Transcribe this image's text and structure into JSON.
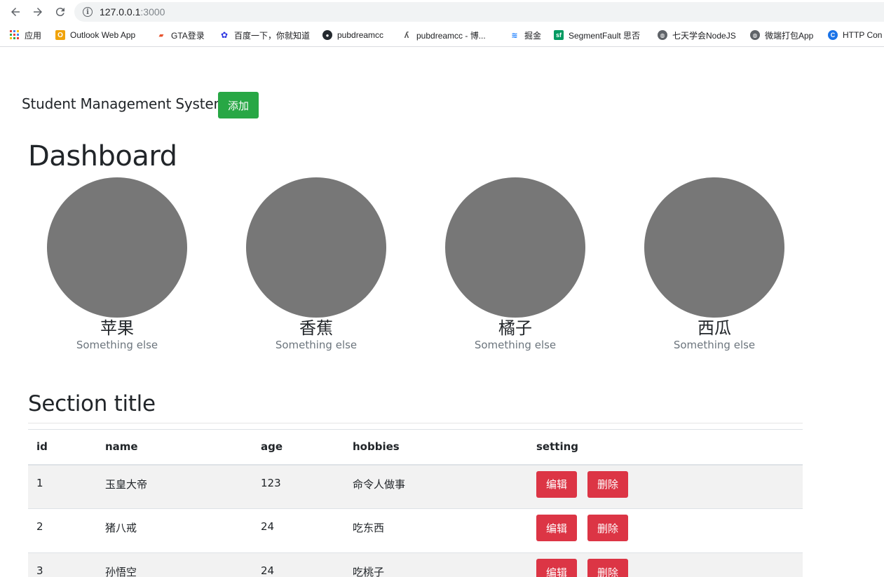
{
  "browser": {
    "url_host": "127.0.0.1",
    "url_port": ":3000",
    "bookmarks": [
      {
        "label": "应用",
        "icon": "apps-grid-icon",
        "color": "#4285f4"
      },
      {
        "label": "Outlook Web App",
        "icon": "outlook-icon",
        "color": "#f0a30a"
      },
      {
        "label": "GTA登录",
        "icon": "gta-icon",
        "color": "#e8542e"
      },
      {
        "label": "百度一下，你就知道",
        "icon": "baidu-icon",
        "color": "#2932e1"
      },
      {
        "label": "pubdreamcc",
        "icon": "github-icon",
        "color": "#24292e"
      },
      {
        "label": "pubdreamcc - 博...",
        "icon": "cnblogs-icon",
        "color": "#555555"
      },
      {
        "label": "掘金",
        "icon": "juejin-icon",
        "color": "#1e80ff"
      },
      {
        "label": "SegmentFault 思否",
        "icon": "segmentfault-icon",
        "color": "#009a61"
      },
      {
        "label": "七天学会NodeJS",
        "icon": "globe-icon",
        "color": "#5f6368"
      },
      {
        "label": "微端打包App",
        "icon": "globe-icon",
        "color": "#5f6368"
      },
      {
        "label": "HTTP Con",
        "icon": "http-icon",
        "color": "#1a73e8"
      }
    ]
  },
  "header": {
    "brand": "Student Management System",
    "add_label": "添加"
  },
  "dashboard": {
    "title": "Dashboard",
    "cards": [
      {
        "title": "苹果",
        "subtitle": "Something else"
      },
      {
        "title": "香蕉",
        "subtitle": "Something else"
      },
      {
        "title": "橘子",
        "subtitle": "Something else"
      },
      {
        "title": "西瓜",
        "subtitle": "Something else"
      }
    ]
  },
  "section": {
    "title": "Section title",
    "columns": [
      "id",
      "name",
      "age",
      "hobbies",
      "setting"
    ],
    "edit_label": "编辑",
    "delete_label": "删除",
    "rows": [
      {
        "id": "1",
        "name": "玉皇大帝",
        "age": "123",
        "hobbies": "命令人做事"
      },
      {
        "id": "2",
        "name": "猪八戒",
        "age": "24",
        "hobbies": "吃东西"
      },
      {
        "id": "3",
        "name": "孙悟空",
        "age": "24",
        "hobbies": "吃桃子"
      }
    ]
  },
  "colors": {
    "success": "#28a745",
    "danger": "#dc3545",
    "placeholder": "#777777"
  }
}
